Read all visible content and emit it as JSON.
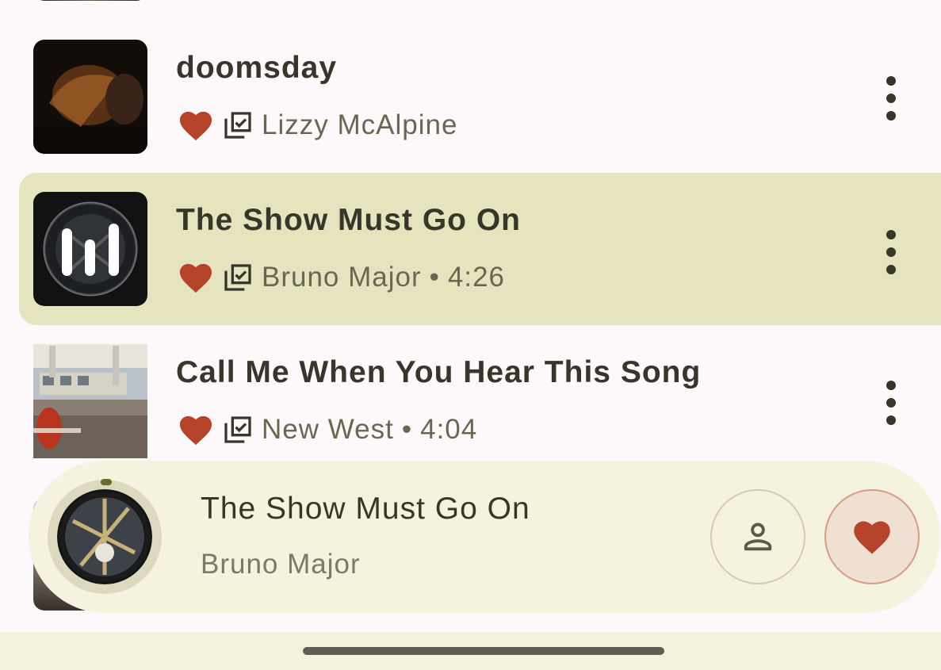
{
  "songs": [
    {
      "title": "doomsday",
      "artist": "Lizzy McAlpine",
      "duration": "",
      "favorite": true,
      "downloaded": true,
      "playing": false
    },
    {
      "title": "The Show Must Go On",
      "artist": "Bruno Major",
      "duration": "4:26",
      "favorite": true,
      "downloaded": true,
      "playing": true
    },
    {
      "title": "Call Me When You Hear This Song",
      "artist": "New West",
      "duration": "4:04",
      "favorite": true,
      "downloaded": true,
      "playing": false
    }
  ],
  "separator": "•",
  "now_playing": {
    "title": "The Show Must Go On",
    "artist": "Bruno Major",
    "icons": {
      "artist_button": "person-icon",
      "favorite_button": "heart-icon"
    }
  },
  "colors": {
    "accent_heart": "#b5432a",
    "playing_row_bg": "#e6e3bf",
    "player_bg": "#f5f2de",
    "text_primary": "#37362a",
    "text_secondary": "#686852"
  }
}
